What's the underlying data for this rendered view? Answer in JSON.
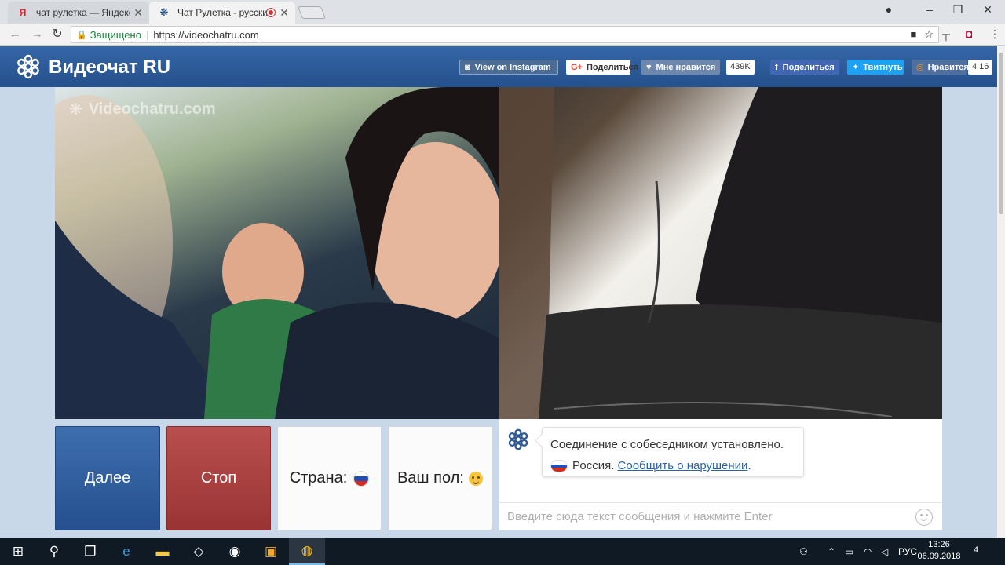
{
  "browser": {
    "tabs": [
      {
        "favicon": "Я",
        "title": "чат рулетка — Яндекс: н",
        "close": "✕"
      },
      {
        "favicon": "❋",
        "title": "Чат Рулетка - русски",
        "close": "✕"
      }
    ],
    "secure_label": "Защищено",
    "url": "https://videochatru.com"
  },
  "site": {
    "title": "Видеочат RU",
    "social": {
      "instagram": "View on Instagram",
      "gplus_icon": "G+",
      "gplus": "Поделиться",
      "like": "Мне нравится",
      "like_count": "439K",
      "facebook": "Поделиться",
      "twitter": "Твитнуть",
      "ok": "Нравится",
      "ok_count": "4 16"
    },
    "watermark": "Videochatru.com"
  },
  "controls": {
    "next": "Далее",
    "stop": "Стоп",
    "country": "Страна:",
    "gender": "Ваш пол:"
  },
  "chat": {
    "message": "Соединение с собеседником установлено.",
    "country": "Россия.",
    "report_link": "Сообщить о нарушении",
    "period": ".",
    "input_placeholder": "Введите сюда текст сообщения и нажмите Enter"
  },
  "taskbar": {
    "lang": "РУС",
    "time": "13:26",
    "date": "06.09.2018",
    "notifications": "4"
  },
  "colors": {
    "header": "#2d5994",
    "next_button": "#2f5e9f",
    "stop_button": "#a93f3f",
    "link": "#2962a8"
  }
}
